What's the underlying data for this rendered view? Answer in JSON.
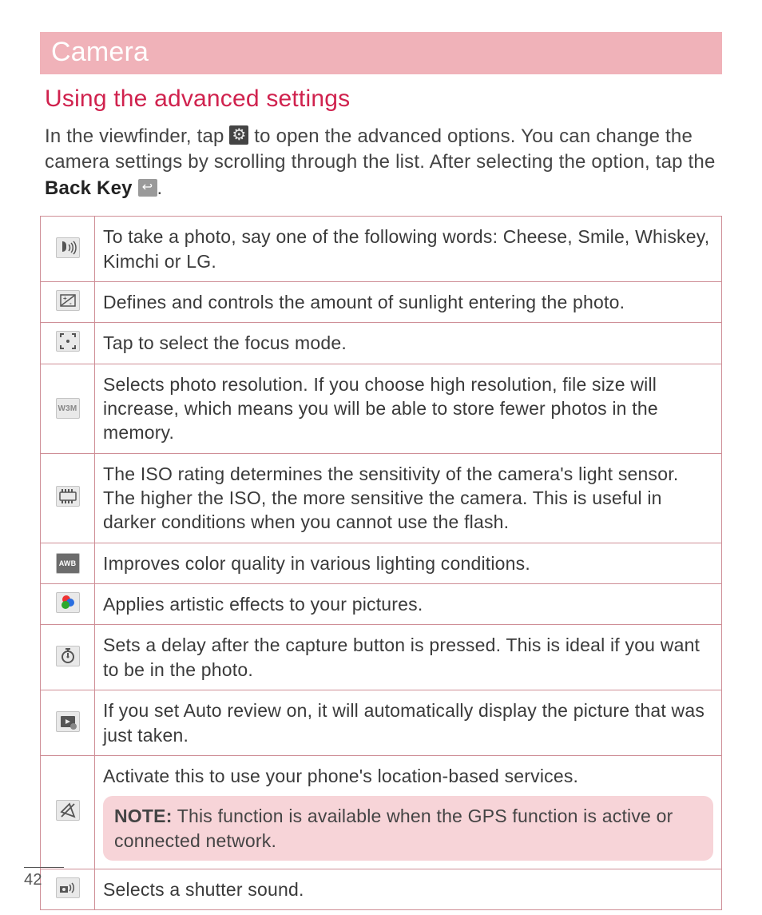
{
  "header": {
    "title": "Camera"
  },
  "section": {
    "title": "Using the advanced settings"
  },
  "intro": {
    "part1": "In the viewfinder, tap ",
    "part2": " to open the advanced options. You can change the camera settings by scrolling through the list. After selecting the option, tap the ",
    "back_key_label": "Back Key",
    "part3": "."
  },
  "rows": [
    {
      "icon": "voice-shutter-icon",
      "desc": "To take a photo, say one of the following words: Cheese, Smile, Whiskey, Kimchi or LG."
    },
    {
      "icon": "brightness-adjust-icon",
      "desc": "Defines and controls the amount of sunlight entering the photo."
    },
    {
      "icon": "focus-mode-icon",
      "desc": "Tap to select the focus mode."
    },
    {
      "icon": "resolution-icon",
      "label": "W3M",
      "desc": "Selects photo resolution. If you choose high resolution, file size will increase, which means you will be able to store fewer photos in the memory."
    },
    {
      "icon": "iso-icon",
      "desc": "The ISO rating determines the sensitivity of the camera's light sensor. The higher the ISO, the more sensitive the camera. This is useful in darker conditions when you cannot use the flash."
    },
    {
      "icon": "white-balance-icon",
      "label": "AWB",
      "desc": "Improves color quality in various lighting conditions."
    },
    {
      "icon": "color-effect-icon",
      "desc": "Applies artistic effects to your pictures."
    },
    {
      "icon": "timer-icon",
      "desc": "Sets a delay after the capture button is pressed. This is ideal if you want to be in the photo."
    },
    {
      "icon": "auto-review-icon",
      "desc": "If you set Auto review on, it will automatically display the picture that was just taken."
    },
    {
      "icon": "geotag-icon",
      "desc": "Activate this to use your phone's location-based services.",
      "note_label": "NOTE:",
      "note_text": " This function is available when the GPS function is active or connected network."
    },
    {
      "icon": "shutter-sound-icon",
      "desc": "Selects a shutter sound."
    }
  ],
  "page_number": "42"
}
